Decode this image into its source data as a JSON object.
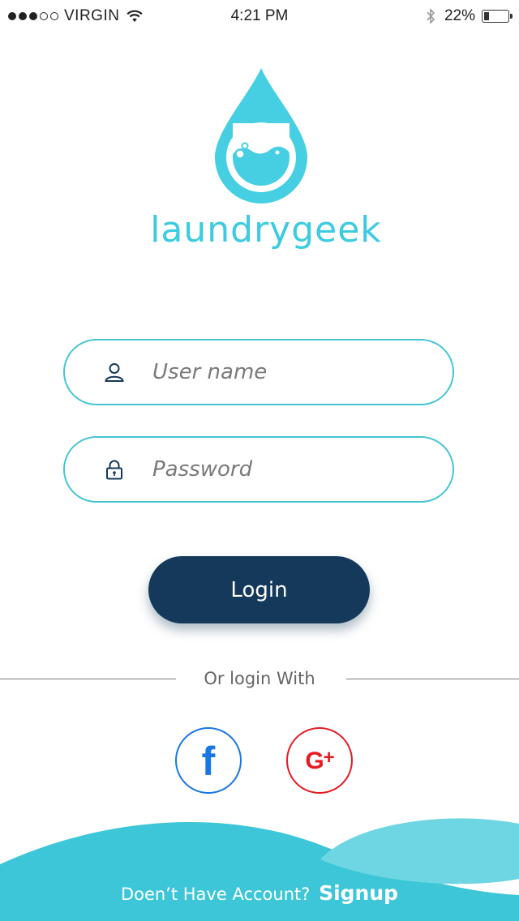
{
  "status_bar": {
    "carrier": "VIRGIN",
    "time": "4:21 PM",
    "battery_percent": "22%",
    "battery_level": 0.22,
    "signal_bars": 3,
    "signal_total": 5,
    "icons": [
      "signal-dots",
      "wifi-icon",
      "bluetooth-icon",
      "battery-icon"
    ]
  },
  "brand": {
    "name": "laundrygeek",
    "logo_icon": "water-drop-logo",
    "color": "#3ccbe0"
  },
  "form": {
    "username": {
      "placeholder": "User name",
      "value": "",
      "icon": "user-icon"
    },
    "password": {
      "placeholder": "Password",
      "value": "",
      "icon": "lock-icon"
    },
    "login_label": "Login"
  },
  "divider": {
    "label": "Or login With"
  },
  "social": {
    "facebook_label": "f",
    "google_label": "G",
    "google_plus": "+"
  },
  "footer": {
    "prompt": "Doen’t Have Account?",
    "signup_label": "Signup"
  },
  "colors": {
    "accent": "#46c4d6",
    "button": "#15395a",
    "facebook": "#1877e5",
    "google": "#e51b23",
    "wave_dark": "#3cc6d8",
    "wave_light": "#6ed6e3"
  }
}
